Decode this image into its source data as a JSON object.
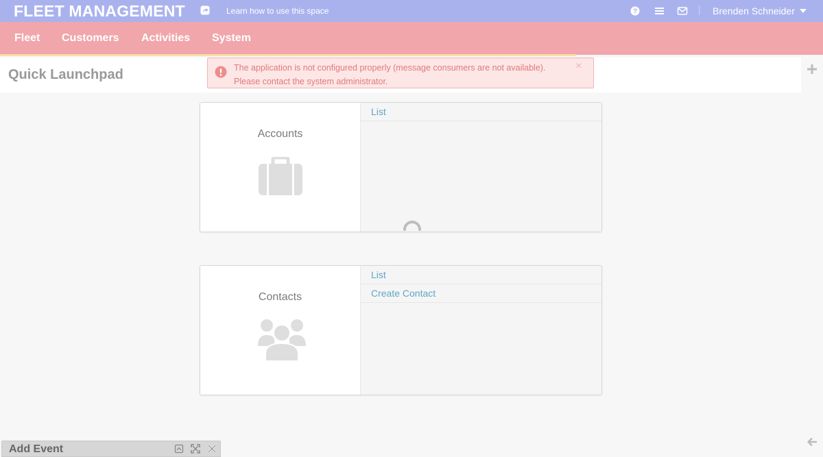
{
  "header": {
    "app_title": "FLEET MANAGEMENT",
    "learn_link": "Learn how to use this space",
    "user_name": "Brenden Schneider",
    "icons": [
      "help-icon",
      "list-icon",
      "mail-icon",
      "share-icon"
    ]
  },
  "nav": {
    "items": [
      "Fleet",
      "Customers",
      "Activities",
      "System"
    ]
  },
  "page": {
    "title": "Quick Launchpad"
  },
  "alert": {
    "line1": "The application is not configured properly (message consumers are not available).",
    "line2": "Please contact the system administrator.",
    "close": "×"
  },
  "widgets": [
    {
      "title": "Accounts",
      "icon": "briefcase-icon",
      "links": [
        "List"
      ]
    },
    {
      "title": "Contacts",
      "icon": "users-icon",
      "links": [
        "List",
        "Create Contact"
      ]
    }
  ],
  "footer": {
    "event_title": "Add Event"
  },
  "colors": {
    "header_bg": "#aab2ee",
    "nav_bg": "#f0a6aa",
    "alert_bg": "#fde6e6",
    "alert_text": "#e07a7a",
    "link": "#5fa6c8"
  }
}
